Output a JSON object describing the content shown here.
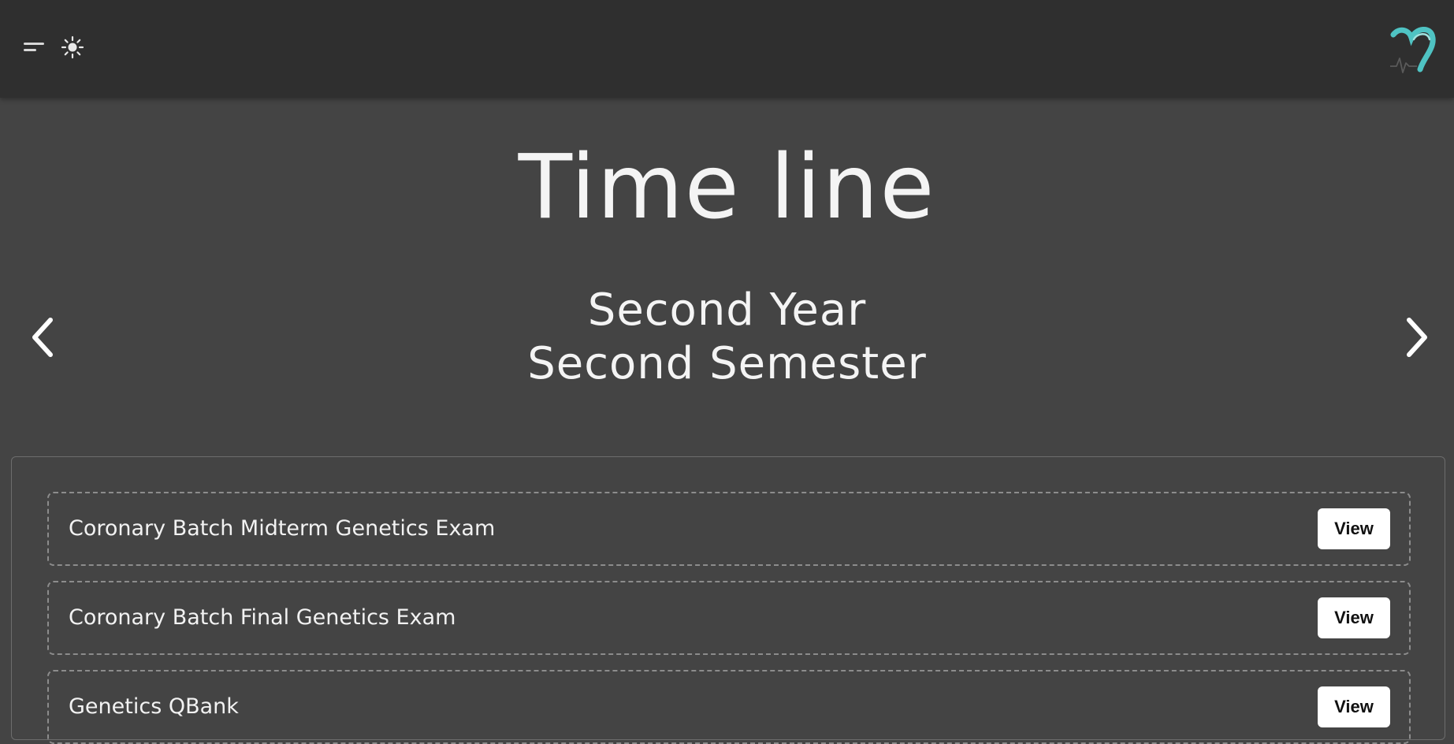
{
  "header": {
    "menu_icon": "menu-icon",
    "theme_icon": "sun-icon",
    "logo_icon": "heart-pulse-logo",
    "colors": {
      "topbar": "#2f2f2f",
      "background": "#444444",
      "logo_accent": "#4fc3c3"
    }
  },
  "main": {
    "title": "Time line",
    "period": {
      "year": "Second Year",
      "semester": "Second Semester"
    },
    "prev_icon": "chevron-left-icon",
    "next_icon": "chevron-right-icon"
  },
  "items": [
    {
      "label": "Coronary Batch Midterm Genetics Exam",
      "button": "View"
    },
    {
      "label": "Coronary Batch Final Genetics Exam",
      "button": "View"
    },
    {
      "label": "Genetics QBank",
      "button": "View"
    }
  ]
}
